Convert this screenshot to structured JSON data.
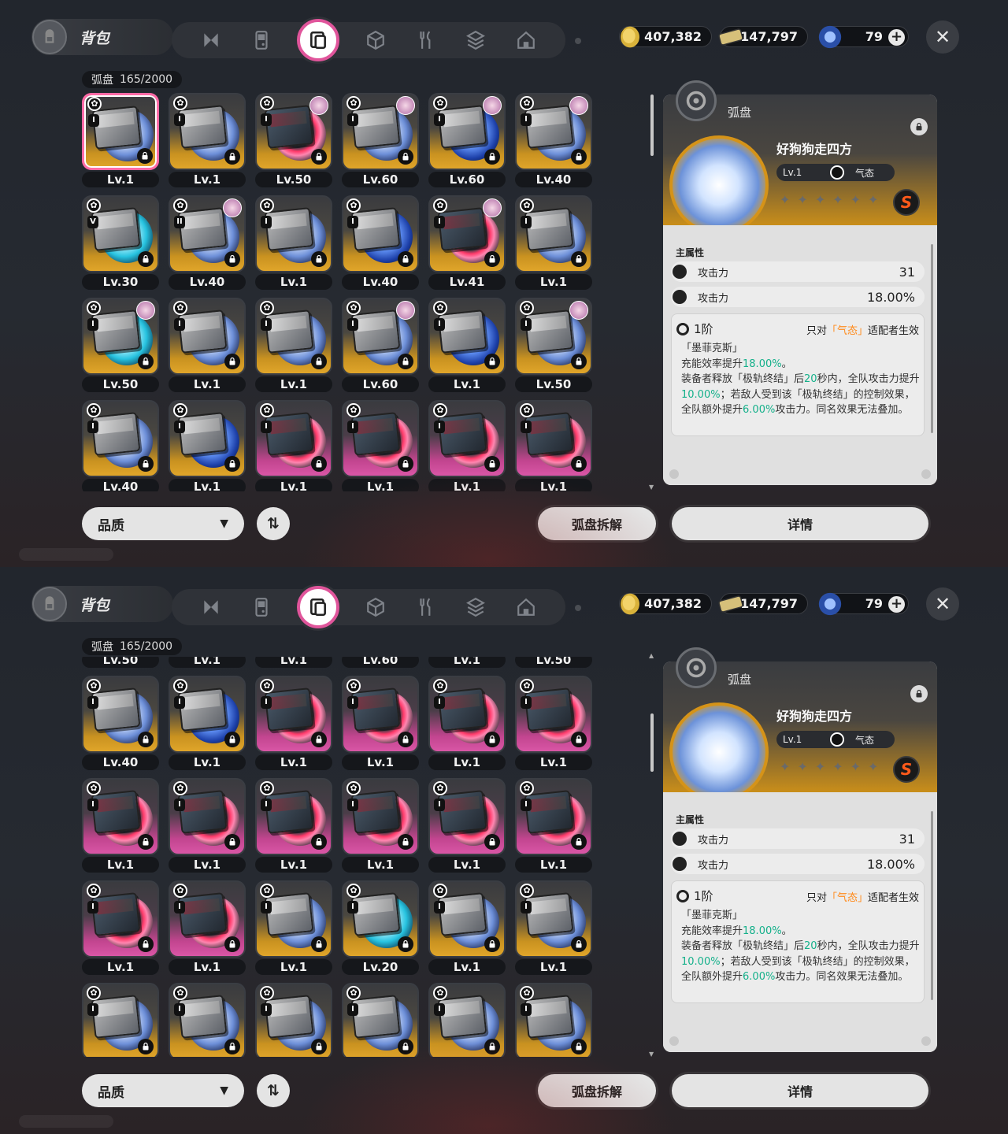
{
  "ui": {
    "title": "背包",
    "category_label": "弧盘",
    "capacity": "165/2000",
    "currencies": [
      {
        "icon": "gold-coin-icon",
        "value": "407,382"
      },
      {
        "icon": "ticket-icon",
        "value": "147,797"
      },
      {
        "icon": "crystal-icon",
        "value": "79"
      }
    ],
    "tabs": [
      "n-logo-icon",
      "handheld-console-icon",
      "disc-case-icon",
      "cube-icon",
      "fork-knife-icon",
      "package-icon",
      "home-icon"
    ],
    "active_tab_index": 2,
    "sort_label": "品质",
    "dismantle_label": "弧盘拆解",
    "details_label": "详情"
  },
  "detail": {
    "category": "弧盘",
    "name": "好狗狗走四方",
    "level": "Lv.1",
    "attribute": "气态",
    "rank": "S",
    "main_attr_header": "主属性",
    "stats": [
      {
        "name": "攻击力",
        "value": "31"
      },
      {
        "name": "攻击力",
        "value": "18.00%"
      }
    ],
    "effect_tier": "1阶",
    "effect_note_pre": "只对",
    "effect_note_attr": "「气态」",
    "effect_note_post": "适配者生效",
    "effect_name": "「墨菲克斯」",
    "effect_line1_pre": "充能效率提升",
    "effect_line1_val": "18.00%",
    "effect_line1_post": "。",
    "effect_line2_a": "装备者释放「极轨终结」后",
    "effect_line2_b": "20",
    "effect_line2_c": "秒内，全队攻击力提升",
    "effect_line2_d": "10.00%",
    "effect_line2_e": "；若敌人受到该「极轨终结」的控制效果，全队额外提升",
    "effect_line2_f": "6.00%",
    "effect_line2_g": "攻击力。同名效果无法叠加。"
  },
  "grid_top": [
    {
      "lv": "Lv.1",
      "bg": "gold",
      "disc": "blue",
      "badge": "I",
      "avatar": false,
      "selected": true
    },
    {
      "lv": "Lv.1",
      "bg": "gold",
      "disc": "blue",
      "badge": "I",
      "avatar": false
    },
    {
      "lv": "Lv.50",
      "bg": "gold",
      "disc": "red",
      "badge": "I",
      "avatar": true
    },
    {
      "lv": "Lv.60",
      "bg": "gold",
      "disc": "blue",
      "badge": "I",
      "avatar": true
    },
    {
      "lv": "Lv.60",
      "bg": "gold",
      "disc": "navy",
      "badge": "I",
      "avatar": true
    },
    {
      "lv": "Lv.40",
      "bg": "gold",
      "disc": "blue",
      "badge": "I",
      "avatar": true
    },
    {
      "lv": "Lv.30",
      "bg": "gold",
      "disc": "teal",
      "badge": "V",
      "avatar": false
    },
    {
      "lv": "Lv.40",
      "bg": "gold",
      "disc": "blue",
      "badge": "II",
      "avatar": true
    },
    {
      "lv": "Lv.1",
      "bg": "gold",
      "disc": "blue",
      "badge": "I",
      "avatar": false
    },
    {
      "lv": "Lv.40",
      "bg": "gold",
      "disc": "navy",
      "badge": "I",
      "avatar": false
    },
    {
      "lv": "Lv.41",
      "bg": "gold",
      "disc": "red",
      "badge": "I",
      "avatar": true
    },
    {
      "lv": "Lv.1",
      "bg": "gold",
      "disc": "blue",
      "badge": "I",
      "avatar": false
    },
    {
      "lv": "Lv.50",
      "bg": "gold",
      "disc": "teal",
      "badge": "I",
      "avatar": true
    },
    {
      "lv": "Lv.1",
      "bg": "gold",
      "disc": "blue",
      "badge": "I",
      "avatar": false
    },
    {
      "lv": "Lv.1",
      "bg": "gold",
      "disc": "blue",
      "badge": "I",
      "avatar": false
    },
    {
      "lv": "Lv.60",
      "bg": "gold",
      "disc": "blue",
      "badge": "I",
      "avatar": true
    },
    {
      "lv": "Lv.1",
      "bg": "gold",
      "disc": "navy",
      "badge": "I",
      "avatar": false
    },
    {
      "lv": "Lv.50",
      "bg": "gold",
      "disc": "blue",
      "badge": "I",
      "avatar": true
    },
    {
      "lv": "Lv.40",
      "bg": "gold",
      "disc": "blue",
      "badge": "I",
      "avatar": false
    },
    {
      "lv": "Lv.1",
      "bg": "gold",
      "disc": "navy",
      "badge": "I",
      "avatar": false
    },
    {
      "lv": "Lv.1",
      "bg": "pink",
      "disc": "red",
      "badge": "I",
      "avatar": false
    },
    {
      "lv": "Lv.1",
      "bg": "pink",
      "disc": "red",
      "badge": "I",
      "avatar": false
    },
    {
      "lv": "Lv.1",
      "bg": "pink",
      "disc": "red",
      "badge": "I",
      "avatar": false
    },
    {
      "lv": "Lv.1",
      "bg": "pink",
      "disc": "red",
      "badge": "I",
      "avatar": false
    }
  ],
  "grid_bottom": [
    {
      "lv": "Lv.50",
      "bg": "gold",
      "disc": "teal",
      "badge": "",
      "avatar": false
    },
    {
      "lv": "Lv.1",
      "bg": "gold",
      "disc": "blue",
      "badge": "",
      "avatar": false
    },
    {
      "lv": "Lv.1",
      "bg": "gold",
      "disc": "blue",
      "badge": "",
      "avatar": false
    },
    {
      "lv": "Lv.60",
      "bg": "gold",
      "disc": "blue",
      "badge": "",
      "avatar": false
    },
    {
      "lv": "Lv.1",
      "bg": "gold",
      "disc": "navy",
      "badge": "",
      "avatar": false
    },
    {
      "lv": "Lv.50",
      "bg": "gold",
      "disc": "blue",
      "badge": "",
      "avatar": false
    },
    {
      "lv": "Lv.40",
      "bg": "gold",
      "disc": "blue",
      "badge": "I",
      "avatar": false
    },
    {
      "lv": "Lv.1",
      "bg": "gold",
      "disc": "navy",
      "badge": "I",
      "avatar": false
    },
    {
      "lv": "Lv.1",
      "bg": "pink",
      "disc": "red",
      "badge": "I",
      "avatar": false
    },
    {
      "lv": "Lv.1",
      "bg": "pink",
      "disc": "red",
      "badge": "I",
      "avatar": false
    },
    {
      "lv": "Lv.1",
      "bg": "pink",
      "disc": "red",
      "badge": "I",
      "avatar": false
    },
    {
      "lv": "Lv.1",
      "bg": "pink",
      "disc": "red",
      "badge": "I",
      "avatar": false
    },
    {
      "lv": "Lv.1",
      "bg": "pink",
      "disc": "red",
      "badge": "I",
      "avatar": false
    },
    {
      "lv": "Lv.1",
      "bg": "pink",
      "disc": "red",
      "badge": "I",
      "avatar": false
    },
    {
      "lv": "Lv.1",
      "bg": "pink",
      "disc": "red",
      "badge": "I",
      "avatar": false
    },
    {
      "lv": "Lv.1",
      "bg": "pink",
      "disc": "red",
      "badge": "I",
      "avatar": false
    },
    {
      "lv": "Lv.1",
      "bg": "pink",
      "disc": "red",
      "badge": "I",
      "avatar": false
    },
    {
      "lv": "Lv.1",
      "bg": "pink",
      "disc": "red",
      "badge": "I",
      "avatar": false
    },
    {
      "lv": "Lv.1",
      "bg": "pink",
      "disc": "red",
      "badge": "I",
      "avatar": false
    },
    {
      "lv": "Lv.1",
      "bg": "pink",
      "disc": "red",
      "badge": "I",
      "avatar": false
    },
    {
      "lv": "Lv.1",
      "bg": "gold",
      "disc": "blue",
      "badge": "I",
      "avatar": false
    },
    {
      "lv": "Lv.20",
      "bg": "gold",
      "disc": "teal",
      "badge": "I",
      "avatar": false
    },
    {
      "lv": "Lv.1",
      "bg": "gold",
      "disc": "blue",
      "badge": "I",
      "avatar": false
    },
    {
      "lv": "Lv.1",
      "bg": "gold",
      "disc": "blue",
      "badge": "I",
      "avatar": false
    },
    {
      "lv": "",
      "bg": "gold",
      "disc": "blue",
      "badge": "I",
      "avatar": false
    },
    {
      "lv": "",
      "bg": "gold",
      "disc": "blue",
      "badge": "I",
      "avatar": false
    },
    {
      "lv": "",
      "bg": "gold",
      "disc": "blue",
      "badge": "I",
      "avatar": false
    },
    {
      "lv": "",
      "bg": "gold",
      "disc": "blue",
      "badge": "I",
      "avatar": false
    },
    {
      "lv": "",
      "bg": "gold",
      "disc": "blue",
      "badge": "I",
      "avatar": false
    },
    {
      "lv": "",
      "bg": "gold",
      "disc": "blue",
      "badge": "I",
      "avatar": false
    }
  ]
}
